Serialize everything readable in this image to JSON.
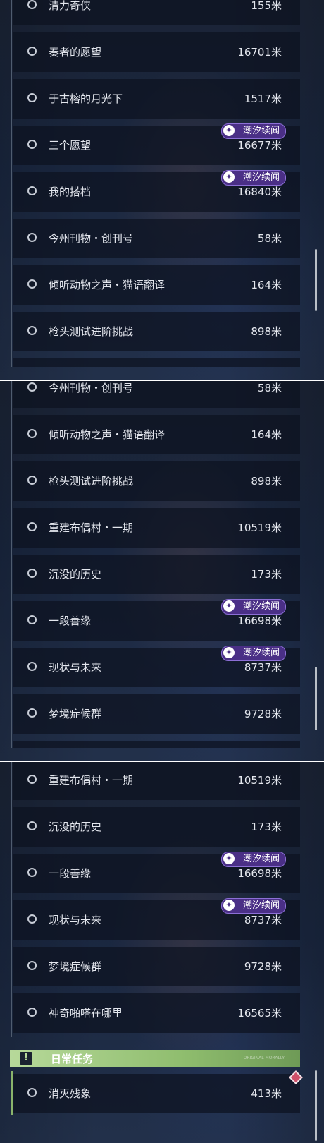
{
  "event_badge": "潮汐续闻",
  "panel1": {
    "rows": [
      {
        "name": "清力奇侠",
        "dist": "155米"
      },
      {
        "name": "奏者的愿望",
        "dist": "16701米"
      },
      {
        "name": "于古榕的月光下",
        "dist": "1517米"
      },
      {
        "name": "三个愿望",
        "dist": "16677米",
        "badge": true
      },
      {
        "name": "我的搭档",
        "dist": "16840米",
        "badge": true
      },
      {
        "name": "今州刊物・创刊号",
        "dist": "58米"
      },
      {
        "name": "倾听动物之声・猫语翻译",
        "dist": "164米"
      },
      {
        "name": "枪头测试进阶挑战",
        "dist": "898米"
      }
    ]
  },
  "panel2": {
    "rows": [
      {
        "name": "今州刊物・创刊号",
        "dist": "58米"
      },
      {
        "name": "倾听动物之声・猫语翻译",
        "dist": "164米"
      },
      {
        "name": "枪头测试进阶挑战",
        "dist": "898米"
      },
      {
        "name": "重建布偶村・一期",
        "dist": "10519米"
      },
      {
        "name": "沉没的历史",
        "dist": "173米"
      },
      {
        "name": "一段善缘",
        "dist": "16698米",
        "badge": true
      },
      {
        "name": "现状与未来",
        "dist": "8737米",
        "badge": true
      },
      {
        "name": "梦境症候群",
        "dist": "9728米"
      }
    ]
  },
  "panel3": {
    "rows": [
      {
        "name": "重建布偶村・一期",
        "dist": "10519米"
      },
      {
        "name": "沉没的历史",
        "dist": "173米"
      },
      {
        "name": "一段善缘",
        "dist": "16698米",
        "badge": true
      },
      {
        "name": "现状与未来",
        "dist": "8737米",
        "badge": true
      },
      {
        "name": "梦境症候群",
        "dist": "9728米"
      },
      {
        "name": "神奇啪嗒在哪里",
        "dist": "16565米"
      }
    ],
    "daily": {
      "title": "日常任务",
      "icon": "!",
      "tag": "ORIGINAL MORALLY",
      "rows": [
        {
          "name": "消灭残象",
          "dist": "413米"
        }
      ]
    }
  },
  "colors": {
    "daily_accent": "#9fcf7b",
    "badge_bg": "#4a2f86",
    "tracked_marker": "#d0506a"
  }
}
